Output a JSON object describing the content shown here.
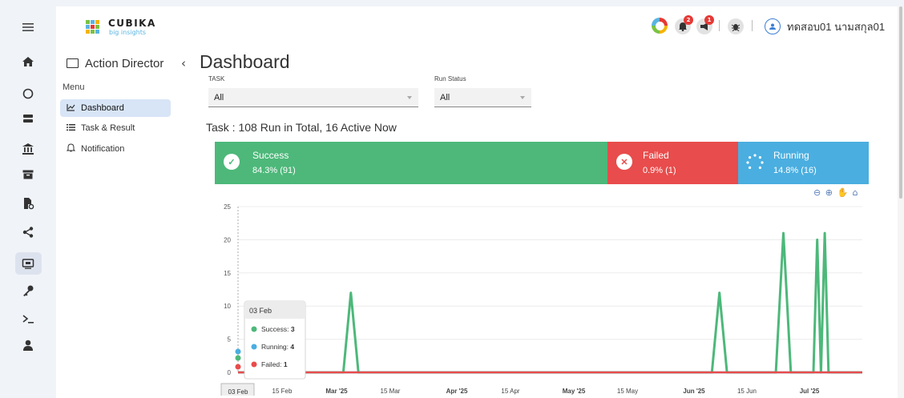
{
  "brand": {
    "name": "CUBIKA",
    "tagline": "big insights"
  },
  "user": {
    "name": "ทดสอบ01 นามสกุล01"
  },
  "notifications": {
    "bell_count": "2",
    "announce_count": "1"
  },
  "rail": {
    "icons": [
      "menu-icon",
      "home-icon",
      "circle-icon",
      "server-icon",
      "bank-icon",
      "archive-icon",
      "file-settings-icon",
      "share-icon",
      "monitor-icon",
      "key-icon",
      "terminal-icon",
      "user-icon"
    ],
    "active": "monitor-icon"
  },
  "sidebar": {
    "title": "Action Director",
    "menu_label": "Menu",
    "items": [
      {
        "label": "Dashboard",
        "icon": "chart-line-icon",
        "active": true
      },
      {
        "label": "Task & Result",
        "icon": "list-icon",
        "active": false
      },
      {
        "label": "Notification",
        "icon": "bell-icon",
        "active": false
      }
    ]
  },
  "page": {
    "title": "Dashboard"
  },
  "filters": {
    "task": {
      "label": "TASK",
      "value": "All"
    },
    "run_status": {
      "label": "Run Status",
      "value": "All"
    }
  },
  "summary": {
    "text": "Task : 108 Run in Total, 16 Active Now"
  },
  "stats": [
    {
      "label": "Success",
      "value": "84.3% (91)",
      "color": "#4db87a",
      "icon": "check-icon"
    },
    {
      "label": "Failed",
      "value": "0.9% (1)",
      "color": "#e84c4c",
      "icon": "close-icon"
    },
    {
      "label": "Running",
      "value": "14.8% (16)",
      "color": "#4aaee0",
      "icon": "spinner-icon"
    }
  ],
  "chart_data": {
    "type": "line",
    "x_labels": [
      "03 Feb",
      "15 Feb",
      "Mar '25",
      "15 Mar",
      "Apr '25",
      "15 Apr",
      "May '25",
      "15 May",
      "Jun '25",
      "15 Jun",
      "Jul '25"
    ],
    "x_labels_bold": [
      false,
      false,
      true,
      false,
      true,
      false,
      true,
      false,
      true,
      false,
      true
    ],
    "ylim": [
      0,
      25
    ],
    "y_ticks": [
      0,
      5,
      10,
      15,
      20,
      25
    ],
    "x_range": [
      "2025-02-01",
      "2025-07-17"
    ],
    "series": [
      {
        "name": "Success",
        "color": "#4db87a",
        "points": [
          [
            "2025-02-01",
            0
          ],
          [
            "2025-03-01",
            0
          ],
          [
            "2025-03-03",
            12
          ],
          [
            "2025-03-05",
            0
          ],
          [
            "2025-06-07",
            0
          ],
          [
            "2025-06-09",
            12
          ],
          [
            "2025-06-11",
            0
          ],
          [
            "2025-06-24",
            0
          ],
          [
            "2025-06-26",
            21
          ],
          [
            "2025-06-28",
            0
          ],
          [
            "2025-07-04",
            0
          ],
          [
            "2025-07-05",
            20
          ],
          [
            "2025-07-06",
            0
          ],
          [
            "2025-07-07",
            21
          ],
          [
            "2025-07-08",
            0
          ],
          [
            "2025-07-17",
            0
          ]
        ]
      },
      {
        "name": "Running",
        "color": "#4aaee0",
        "points": [
          [
            "2025-02-01",
            0
          ],
          [
            "2025-07-17",
            0
          ]
        ]
      },
      {
        "name": "Failed",
        "color": "#e84c4c",
        "points": [
          [
            "2025-02-01",
            0
          ],
          [
            "2025-07-17",
            0
          ]
        ]
      }
    ],
    "tooltip": {
      "title": "03 Feb",
      "rows": [
        {
          "label": "Success:",
          "value": "3",
          "color": "#4db87a"
        },
        {
          "label": "Running:",
          "value": "4",
          "color": "#4aaee0"
        },
        {
          "label": "Failed:",
          "value": "1",
          "color": "#e84c4c"
        }
      ]
    },
    "crosshair_label": "03 Feb"
  }
}
